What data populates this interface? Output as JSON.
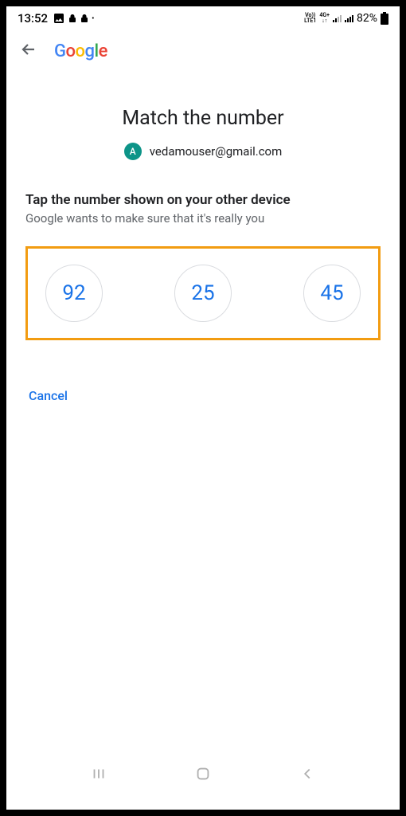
{
  "status": {
    "time": "13:52",
    "battery": "82%"
  },
  "header": {
    "logo_g1": "G",
    "logo_o1": "o",
    "logo_o2": "o",
    "logo_g2": "g",
    "logo_l": "l",
    "logo_e": "e"
  },
  "page": {
    "title": "Match the number",
    "avatar_letter": "A",
    "email": "vedamouser@gmail.com",
    "instruction_title": "Tap the number shown on your other device",
    "instruction_sub": "Google wants to make sure that it's really you",
    "numbers": {
      "n1": "92",
      "n2": "25",
      "n3": "45"
    },
    "cancel": "Cancel"
  }
}
